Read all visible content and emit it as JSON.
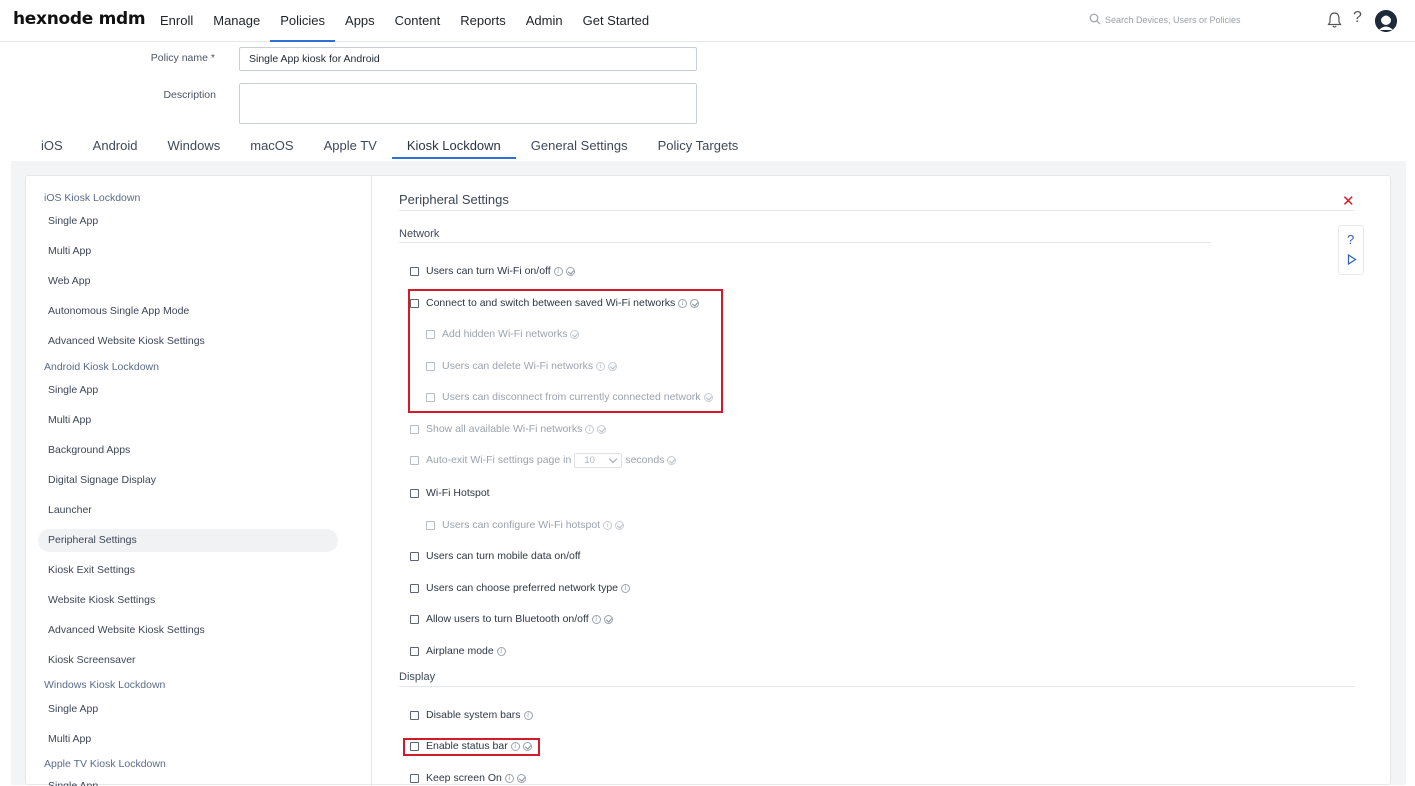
{
  "brand": "hexnode mdm",
  "nav": [
    "Enroll",
    "Manage",
    "Policies",
    "Apps",
    "Content",
    "Reports",
    "Admin",
    "Get Started"
  ],
  "nav_active": "Policies",
  "search": {
    "placeholder": "Search Devices, Users or Policies"
  },
  "policy": {
    "name_label": "Policy name *",
    "name_value": "Single App kiosk for Android",
    "description_label": "Description",
    "description_value": ""
  },
  "tabs": [
    "iOS",
    "Android",
    "Windows",
    "macOS",
    "Apple TV",
    "Kiosk Lockdown",
    "General Settings",
    "Policy Targets"
  ],
  "tab_active": "Kiosk Lockdown",
  "sidebar": {
    "ios_group": "iOS Kiosk Lockdown",
    "ios_items": [
      "Single App",
      "Multi App",
      "Web App",
      "Autonomous Single App Mode",
      "Advanced Website Kiosk Settings"
    ],
    "android_group": "Android Kiosk Lockdown",
    "android_items": [
      "Single App",
      "Multi App",
      "Background Apps",
      "Digital Signage Display",
      "Launcher",
      "Peripheral Settings",
      "Kiosk Exit Settings",
      "Website Kiosk Settings",
      "Advanced Website Kiosk Settings",
      "Kiosk Screensaver"
    ],
    "windows_group": "Windows Kiosk Lockdown",
    "windows_items": [
      "Single App",
      "Multi App"
    ],
    "appletv_group": "Apple TV Kiosk Lockdown",
    "appletv_items": [
      "Single App"
    ],
    "active_item": "Peripheral Settings"
  },
  "main": {
    "title": "Peripheral Settings",
    "network_heading": "Network",
    "display_heading": "Display",
    "options": {
      "wifi_toggle": "Users can turn Wi-Fi on/off",
      "connect_saved": "Connect to and switch between saved Wi-Fi networks",
      "add_hidden": "Add hidden Wi-Fi networks",
      "delete_wifi": "Users can delete Wi-Fi networks",
      "disconnect": "Users can disconnect from currently connected network",
      "show_all": "Show all available Wi-Fi networks",
      "auto_exit_prefix": "Auto-exit Wi-Fi settings page in",
      "auto_exit_value": "10",
      "auto_exit_suffix": "seconds",
      "hotspot": "Wi-Fi Hotspot",
      "hotspot_config": "Users can configure Wi-Fi hotspot",
      "mobile_data": "Users can turn mobile data on/off",
      "network_type": "Users can choose preferred network type",
      "bluetooth": "Allow users to turn Bluetooth on/off",
      "airplane": "Airplane mode",
      "system_bars": "Disable system bars",
      "status_bar": "Enable status bar",
      "screen_on": "Keep screen On"
    }
  },
  "colors": {
    "accent": "#2f6fd6",
    "highlight_box": "#d11a2a",
    "close": "#d11a2a"
  },
  "icons": [
    "search-icon",
    "bell-icon",
    "help-icon",
    "avatar",
    "close-icon",
    "question-icon",
    "play-icon",
    "info-icon",
    "verified-check-icon"
  ]
}
